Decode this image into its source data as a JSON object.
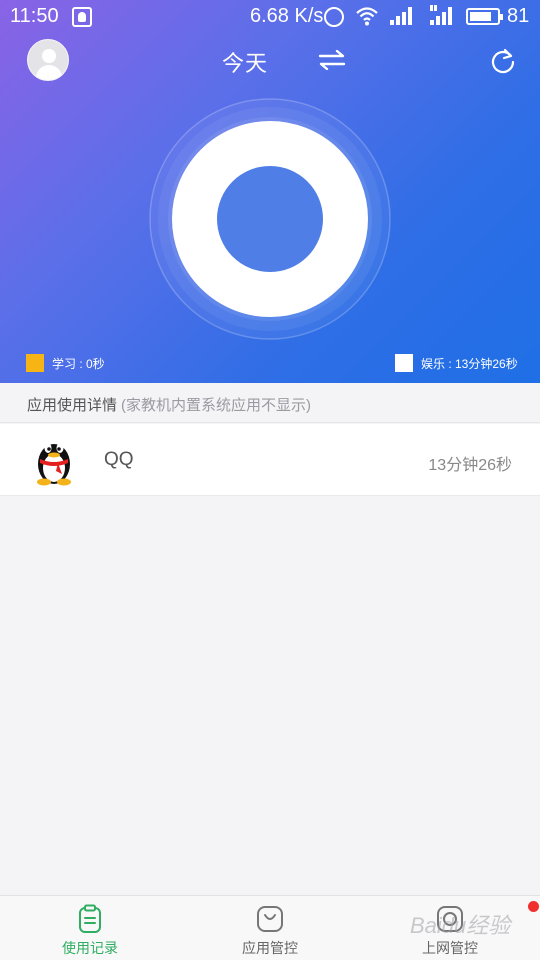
{
  "status_bar": {
    "time": "11:50",
    "net_speed": "6.68 K/s",
    "battery_level": "81",
    "battery_fraction": 0.81
  },
  "header": {
    "title": "今天",
    "avatar_icon": "user-avatar",
    "switch_icon": "swap-arrows-icon",
    "refresh_icon": "refresh-icon"
  },
  "usage_ring": {
    "study_fraction": 0.0,
    "entertainment_fraction": 1.0,
    "colors": {
      "study": "#f7b515",
      "entertainment": "#ffffff",
      "center": "#4f7fe6"
    }
  },
  "legend": {
    "study": "学习 : 0秒",
    "entertainment": "娱乐 : 13分钟26秒"
  },
  "section": {
    "title": "应用使用详情",
    "note": "(家教机内置系统应用不显示)"
  },
  "apps": [
    {
      "name": "QQ",
      "duration": "13分钟26秒",
      "icon": "qq-penguin-icon"
    }
  ],
  "bottom_nav": {
    "items": [
      {
        "label": "使用记录",
        "icon": "clipboard-icon",
        "active": true
      },
      {
        "label": "应用管控",
        "icon": "shopping-bag-icon",
        "active": false
      },
      {
        "label": "上网管控",
        "icon": "globe-icon",
        "active": false,
        "badge": true
      }
    ]
  },
  "watermark": "Baidu经验",
  "colors": {
    "accent_green": "#2fae62",
    "hero_blue": "#1f6fe6",
    "badge_red": "#f0302e"
  }
}
